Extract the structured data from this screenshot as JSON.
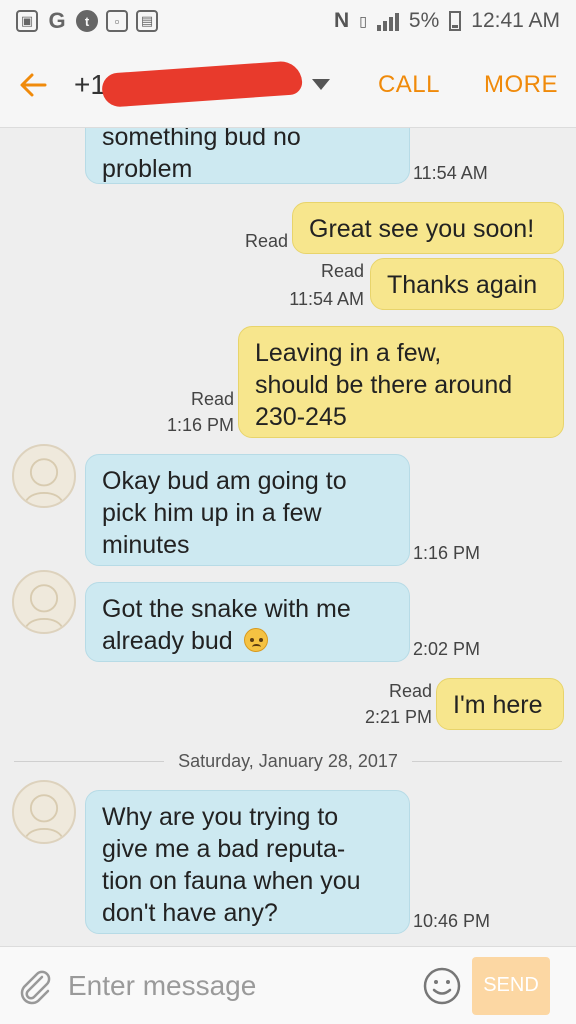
{
  "status_bar": {
    "left_icons": [
      "gallery-icon",
      "google-icon",
      "tumblr-icon",
      "screenshot-icon",
      "briefcase-icon"
    ],
    "battery": "5%",
    "time": "12:41 AM"
  },
  "header": {
    "contact_visible": "+1",
    "call_label": "CALL",
    "more_label": "MORE"
  },
  "messages": [
    {
      "dir": "in",
      "lines": [
        "something bud no",
        "problem"
      ],
      "time": "11:54 AM"
    },
    {
      "dir": "out",
      "lines": [
        "Great see you soon!"
      ],
      "status": "Read"
    },
    {
      "dir": "out",
      "lines": [
        "Thanks again"
      ],
      "status": "Read",
      "time": "11:54 AM"
    },
    {
      "dir": "out",
      "lines": [
        "Leaving in a few,",
        "should be there around",
        "230-245"
      ],
      "status": "Read",
      "time": "1:16 PM"
    },
    {
      "dir": "in",
      "lines": [
        "Okay bud am going to",
        "pick him up in a few",
        "minutes"
      ],
      "time": "1:16 PM"
    },
    {
      "dir": "in",
      "lines": [
        "Got the snake with me",
        "already bud"
      ],
      "time": "2:02 PM"
    },
    {
      "dir": "out",
      "lines": [
        "I'm here"
      ],
      "status": "Read",
      "time": "2:21 PM"
    },
    {
      "dir": "in",
      "lines": [
        "Why are you trying to",
        "give me a bad reputa-",
        "tion on fauna when you",
        "don't have any?"
      ],
      "time": "10:46 PM"
    }
  ],
  "date_divider": "Saturday, January 28, 2017",
  "composer": {
    "placeholder": "Enter message",
    "send_label": "SEND"
  },
  "colors": {
    "accent": "#f08a0a",
    "incoming_bubble": "#cde9f1",
    "outgoing_bubble": "#f7e68d",
    "redaction": "#e83a2c"
  }
}
